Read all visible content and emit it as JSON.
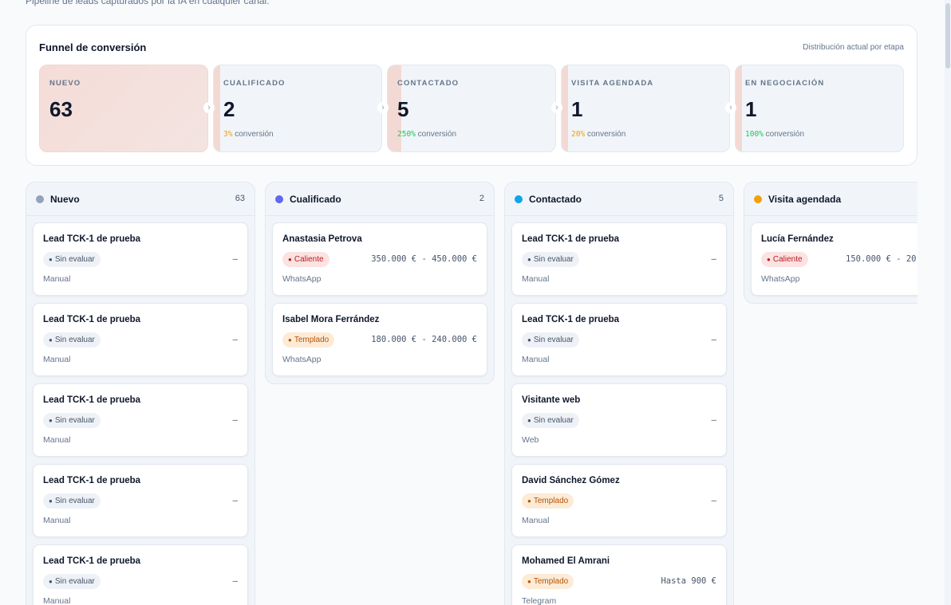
{
  "page": {
    "subtitle": "Pipeline de leads capturados por la IA en cualquier canal."
  },
  "funnel": {
    "title": "Funnel de conversión",
    "note": "Distribución actual por etapa",
    "stages": [
      {
        "label": "NUEVO",
        "count": "63",
        "pct": "",
        "conv": ""
      },
      {
        "label": "CUALIFICADO",
        "count": "2",
        "pct": "3%",
        "conv": " conversión",
        "pct_color": "#f59e0b"
      },
      {
        "label": "CONTACTADO",
        "count": "5",
        "pct": "250%",
        "conv": " conversión",
        "pct_color": "#22c55e"
      },
      {
        "label": "VISITA AGENDADA",
        "count": "1",
        "pct": "20%",
        "conv": " conversión",
        "pct_color": "#f59e0b"
      },
      {
        "label": "EN NEGOCIACIÓN",
        "count": "1",
        "pct": "100%",
        "conv": " conversión",
        "pct_color": "#22c55e"
      }
    ],
    "fill_fractions": [
      1,
      0.03,
      0.08,
      0.016,
      0.016
    ]
  },
  "columns": [
    {
      "title": "Nuevo",
      "count": "63",
      "color": "#94a3b8",
      "cards": [
        {
          "name": "Lead TCK-1 de prueba",
          "badge": "Sin evaluar",
          "range": "—",
          "source": "Manual"
        },
        {
          "name": "Lead TCK-1 de prueba",
          "badge": "Sin evaluar",
          "range": "—",
          "source": "Manual"
        },
        {
          "name": "Lead TCK-1 de prueba",
          "badge": "Sin evaluar",
          "range": "—",
          "source": "Manual"
        },
        {
          "name": "Lead TCK-1 de prueba",
          "badge": "Sin evaluar",
          "range": "—",
          "source": "Manual"
        },
        {
          "name": "Lead TCK-1 de prueba",
          "badge": "Sin evaluar",
          "range": "—",
          "source": "Manual"
        }
      ]
    },
    {
      "title": "Cualificado",
      "count": "2",
      "color": "#6366f1",
      "cards": [
        {
          "name": "Anastasia Petrova",
          "badge": "Caliente",
          "range": "350.000 € - 450.000 €",
          "source": "WhatsApp"
        },
        {
          "name": "Isabel Mora Ferrández",
          "badge": "Templado",
          "range": "180.000 € - 240.000 €",
          "source": "WhatsApp"
        }
      ]
    },
    {
      "title": "Contactado",
      "count": "5",
      "color": "#0ea5e9",
      "cards": [
        {
          "name": "Lead TCK-1 de prueba",
          "badge": "Sin evaluar",
          "range": "—",
          "source": "Manual"
        },
        {
          "name": "Lead TCK-1 de prueba",
          "badge": "Sin evaluar",
          "range": "—",
          "source": "Manual"
        },
        {
          "name": "Visitante web",
          "badge": "Sin evaluar",
          "range": "—",
          "source": "Web"
        },
        {
          "name": "David Sánchez Gómez",
          "badge": "Templado",
          "range": "—",
          "source": "Manual"
        },
        {
          "name": "Mohamed El Amrani",
          "badge": "Templado",
          "range": "Hasta 900 €",
          "source": "Telegram"
        }
      ]
    },
    {
      "title": "Visita agendada",
      "count": "",
      "color": "#f59e0b",
      "cards": [
        {
          "name": "Lucía Fernández",
          "badge": "Caliente",
          "range": "150.000 € - 20",
          "source": "WhatsApp"
        }
      ]
    }
  ],
  "badge_dot": "●"
}
